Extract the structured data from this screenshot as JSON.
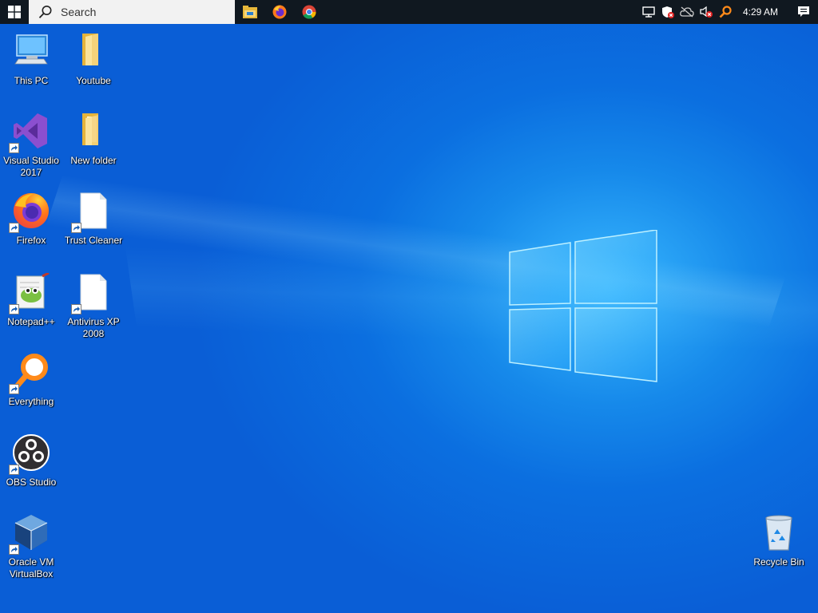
{
  "taskbar": {
    "search_placeholder": "Search",
    "apps": [
      {
        "name": "file-explorer"
      },
      {
        "name": "firefox"
      },
      {
        "name": "chrome"
      }
    ],
    "clock": "4:29 AM"
  },
  "desktop": {
    "icons": [
      {
        "label": "This PC",
        "icon": "computer-icon"
      },
      {
        "label": "Youtube",
        "icon": "folder-icon"
      },
      {
        "label": "Visual Studio 2017",
        "icon": "visual-studio-icon"
      },
      {
        "label": "New folder",
        "icon": "folder-icon"
      },
      {
        "label": "Firefox",
        "icon": "firefox-icon"
      },
      {
        "label": "Trust Cleaner",
        "icon": "blank-file-icon"
      },
      {
        "label": "Notepad++",
        "icon": "notepad-plus-plus-icon"
      },
      {
        "label": "Antivirus XP 2008",
        "icon": "blank-file-icon"
      },
      {
        "label": "Everything",
        "icon": "everything-search-icon"
      },
      {
        "label": "OBS Studio",
        "icon": "obs-icon"
      },
      {
        "label": "Oracle VM VirtualBox",
        "icon": "virtualbox-icon"
      },
      {
        "label": "Recycle Bin",
        "icon": "recycle-bin-icon"
      }
    ]
  },
  "colors": {
    "taskbar": "#101820",
    "desktop_accent": "#0f7ee8"
  }
}
